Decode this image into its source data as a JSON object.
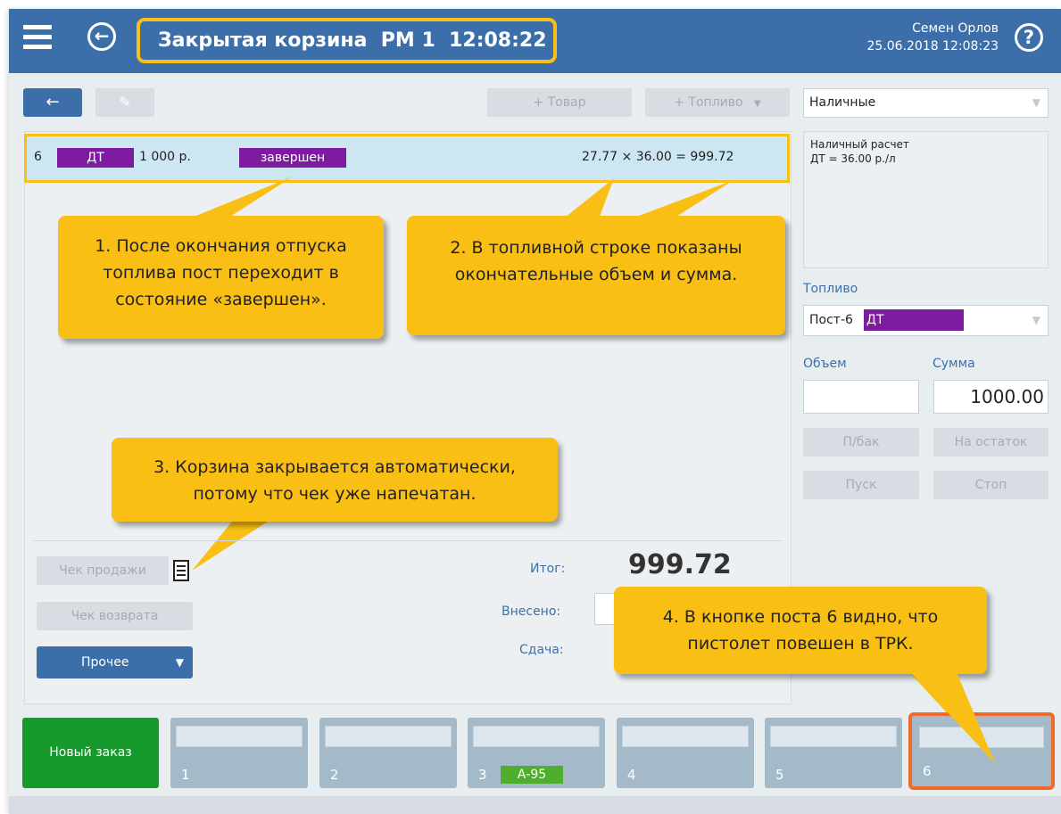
{
  "header": {
    "title": "Закрытая корзина  РМ 1  12:08:22",
    "user_name": "Семен Орлов",
    "datetime": "25.06.2018 12:08:23",
    "help_label": "?",
    "back_label": "←"
  },
  "toolbar": {
    "back_label": "←",
    "edit_label": "✎",
    "add_product": "+ Товар",
    "add_fuel": "+ Топливо",
    "dropdown_arrow": "▼"
  },
  "fuel_line": {
    "post": "6",
    "fuel": "ДТ",
    "amount": "1 000 р.",
    "status": "завершен",
    "calc": "27.77 × 36.00 = 999.72"
  },
  "callouts": {
    "c1": [
      "1. После окончания отпуска",
      "топлива пост переходит в",
      "состояние «завершен»."
    ],
    "c2": [
      "2. В топливной строке показаны",
      "окончательные объем и сумма."
    ],
    "c3": [
      "3. Корзина закрывается автоматически,",
      "потому что чек уже напечатан."
    ],
    "c4": [
      "4. В кнопке поста 6 видно, что",
      "пистолет повешен в ТРК."
    ]
  },
  "actions": {
    "sale_receipt": "Чек продажи",
    "return_receipt": "Чек возврата",
    "other": "Прочее",
    "other_arrow": "▼"
  },
  "totals": {
    "total_label": "Итог:",
    "total_value": "999.72",
    "paid_label": "Внесено:",
    "change_label": "Сдача:"
  },
  "payment": {
    "method": "Наличные",
    "info": [
      "Наличный расчет",
      "ДТ = 36.00 р./л"
    ]
  },
  "fuel_panel": {
    "section_label": "Топливо",
    "post_label": "Пост-6",
    "fuel": "ДТ",
    "volume_label": "Объем",
    "sum_label": "Сумма",
    "volume_value": "",
    "sum_value": "1000.00",
    "full_tank": "П/бак",
    "remainder": "На остаток",
    "start": "Пуск",
    "stop": "Стоп"
  },
  "bottom": {
    "new_order": "Новый заказ",
    "posts": [
      {
        "num": "1",
        "fuel": ""
      },
      {
        "num": "2",
        "fuel": ""
      },
      {
        "num": "3",
        "fuel": "А-95"
      },
      {
        "num": "4",
        "fuel": ""
      },
      {
        "num": "5",
        "fuel": ""
      },
      {
        "num": "6",
        "fuel": ""
      }
    ]
  },
  "colors": {
    "header": "#3c6faa",
    "highlight": "#f9bf14",
    "fuel_tag": "#7d1ca0",
    "new_order": "#169a2b",
    "fuel_a95": "#4fae2e",
    "post_selected_border": "#f06a2a"
  }
}
